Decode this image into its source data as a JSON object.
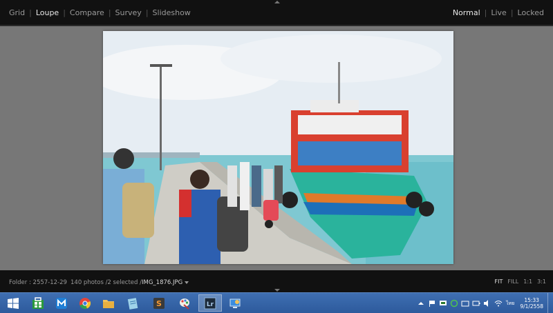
{
  "top_bar": {
    "modules": [
      {
        "label": "Grid",
        "active": false
      },
      {
        "label": "Loupe",
        "active": true
      },
      {
        "label": "Compare",
        "active": false
      },
      {
        "label": "Survey",
        "active": false
      },
      {
        "label": "Slideshow",
        "active": false
      }
    ],
    "view_modes": [
      {
        "label": "Normal",
        "active": true
      },
      {
        "label": "Live",
        "active": false
      },
      {
        "label": "Locked",
        "active": false
      }
    ],
    "separator": "|"
  },
  "filmstrip_bar": {
    "folder": "Folder : 2557-12-29",
    "count": "140 photos /2 selected /",
    "filename": "IMG_1876.JPG",
    "zoom_options": [
      {
        "label": "FIT",
        "active": true
      },
      {
        "label": "FILL",
        "active": false
      },
      {
        "label": "1:1",
        "active": false
      },
      {
        "label": "3:1",
        "active": false
      }
    ]
  },
  "taskbar": {
    "apps": [
      {
        "name": "start-button",
        "icon": "windows-logo-icon"
      },
      {
        "name": "store",
        "icon": "store-icon"
      },
      {
        "name": "maxthon",
        "icon": "maxthon-icon"
      },
      {
        "name": "chrome",
        "icon": "chrome-icon"
      },
      {
        "name": "file-explorer",
        "icon": "folder-icon"
      },
      {
        "name": "notes",
        "icon": "notes-icon"
      },
      {
        "name": "sublime",
        "icon": "sublime-icon"
      },
      {
        "name": "paint",
        "icon": "paint-icon"
      },
      {
        "name": "lightroom",
        "icon": "lightroom-icon",
        "text": "Lr",
        "active": true
      },
      {
        "name": "remote-desktop",
        "icon": "remote-desktop-icon"
      }
    ],
    "clock": {
      "time": "15:33",
      "date": "9/1/2558"
    },
    "tray_lang": "ไทย"
  },
  "colors": {
    "topbar_bg": "#111111",
    "loupe_bg": "#777777",
    "taskbar_bg": "#2d5a9c",
    "active_text": "#e8e8e8",
    "inactive_text": "#9a9a9a"
  }
}
